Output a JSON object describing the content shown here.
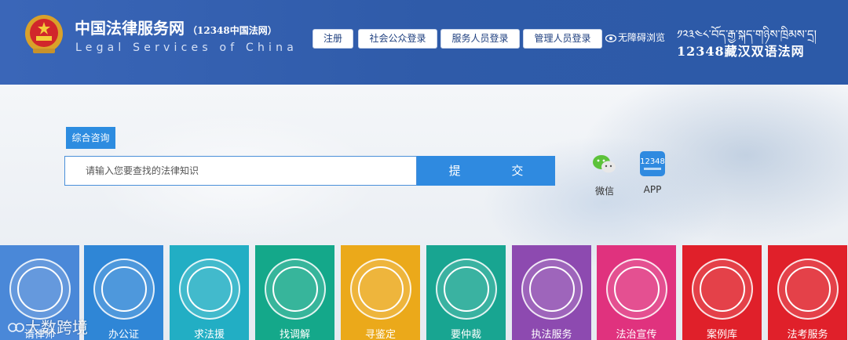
{
  "header": {
    "site_title": "中国法律服务网",
    "site_title_suffix": "（12348中国法网）",
    "site_subtitle": "Legal Services of China",
    "buttons": [
      "注册",
      "社会公众登录",
      "服务人员登录",
      "管理人员登录"
    ],
    "accessibility": "无障碍浏览",
    "tibetan_text": "༡༢༣༤༨་བོད་རྒྱ་སྐད་གཉིས་ཁྲིམས་དྲ།",
    "bilingual_label": "12348藏汉双语法网"
  },
  "search": {
    "tab_label": "综合咨询",
    "placeholder": "请输入您要查找的法律知识",
    "submit_label": "提 交"
  },
  "quick_access": [
    {
      "label": "微信",
      "icon": "wechat-icon"
    },
    {
      "label": "APP",
      "icon": "app-icon",
      "icon_text": "12348"
    }
  ],
  "services": [
    {
      "label": "请律师",
      "color": "#4a88d8"
    },
    {
      "label": "办公证",
      "color": "#2f86d6"
    },
    {
      "label": "求法援",
      "color": "#22aec4"
    },
    {
      "label": "找调解",
      "color": "#14a88a"
    },
    {
      "label": "寻鉴定",
      "color": "#eba91a"
    },
    {
      "label": "要仲裁",
      "color": "#18a591"
    },
    {
      "label": "执法服务",
      "color": "#8d4ab0"
    },
    {
      "label": "法治宣传",
      "color": "#e0327e"
    },
    {
      "label": "案例库",
      "color": "#e0202a"
    },
    {
      "label": "法考服务",
      "color": "#e0202a"
    }
  ],
  "watermark": "大数跨境"
}
